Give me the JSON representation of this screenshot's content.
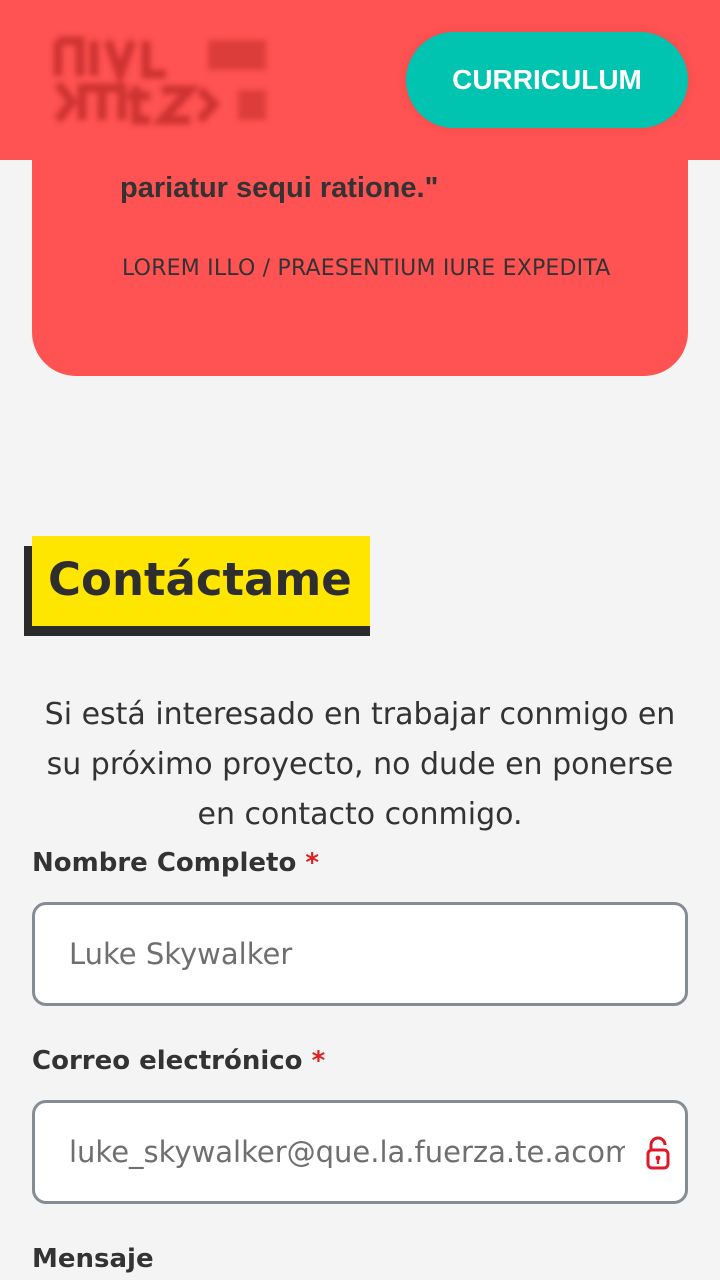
{
  "header": {
    "logo_alt": "Logo",
    "cta_label": "CURRICULUM"
  },
  "testimonial": {
    "quote_end": "pariatur sequi ratione.\"",
    "author": "LOREM ILLO / PRAESENTIUM IURE EXPEDITA"
  },
  "contact": {
    "title": "Contáctame",
    "intro": "Si está interesado en trabajar conmigo en su próximo proyecto, no dude en ponerse en contacto conmigo.",
    "name_label": "Nombre Completo",
    "name_placeholder": "Luke Skywalker",
    "email_label": "Correo electrónico",
    "email_placeholder": "luke_skywalker@que.la.fuerza.te.acompañe.com",
    "message_label": "Mensaje",
    "required_mark": "*"
  },
  "colors": {
    "accent_red": "#ff5252",
    "accent_teal": "#00c4b0",
    "highlight_yellow": "#ffe600"
  }
}
